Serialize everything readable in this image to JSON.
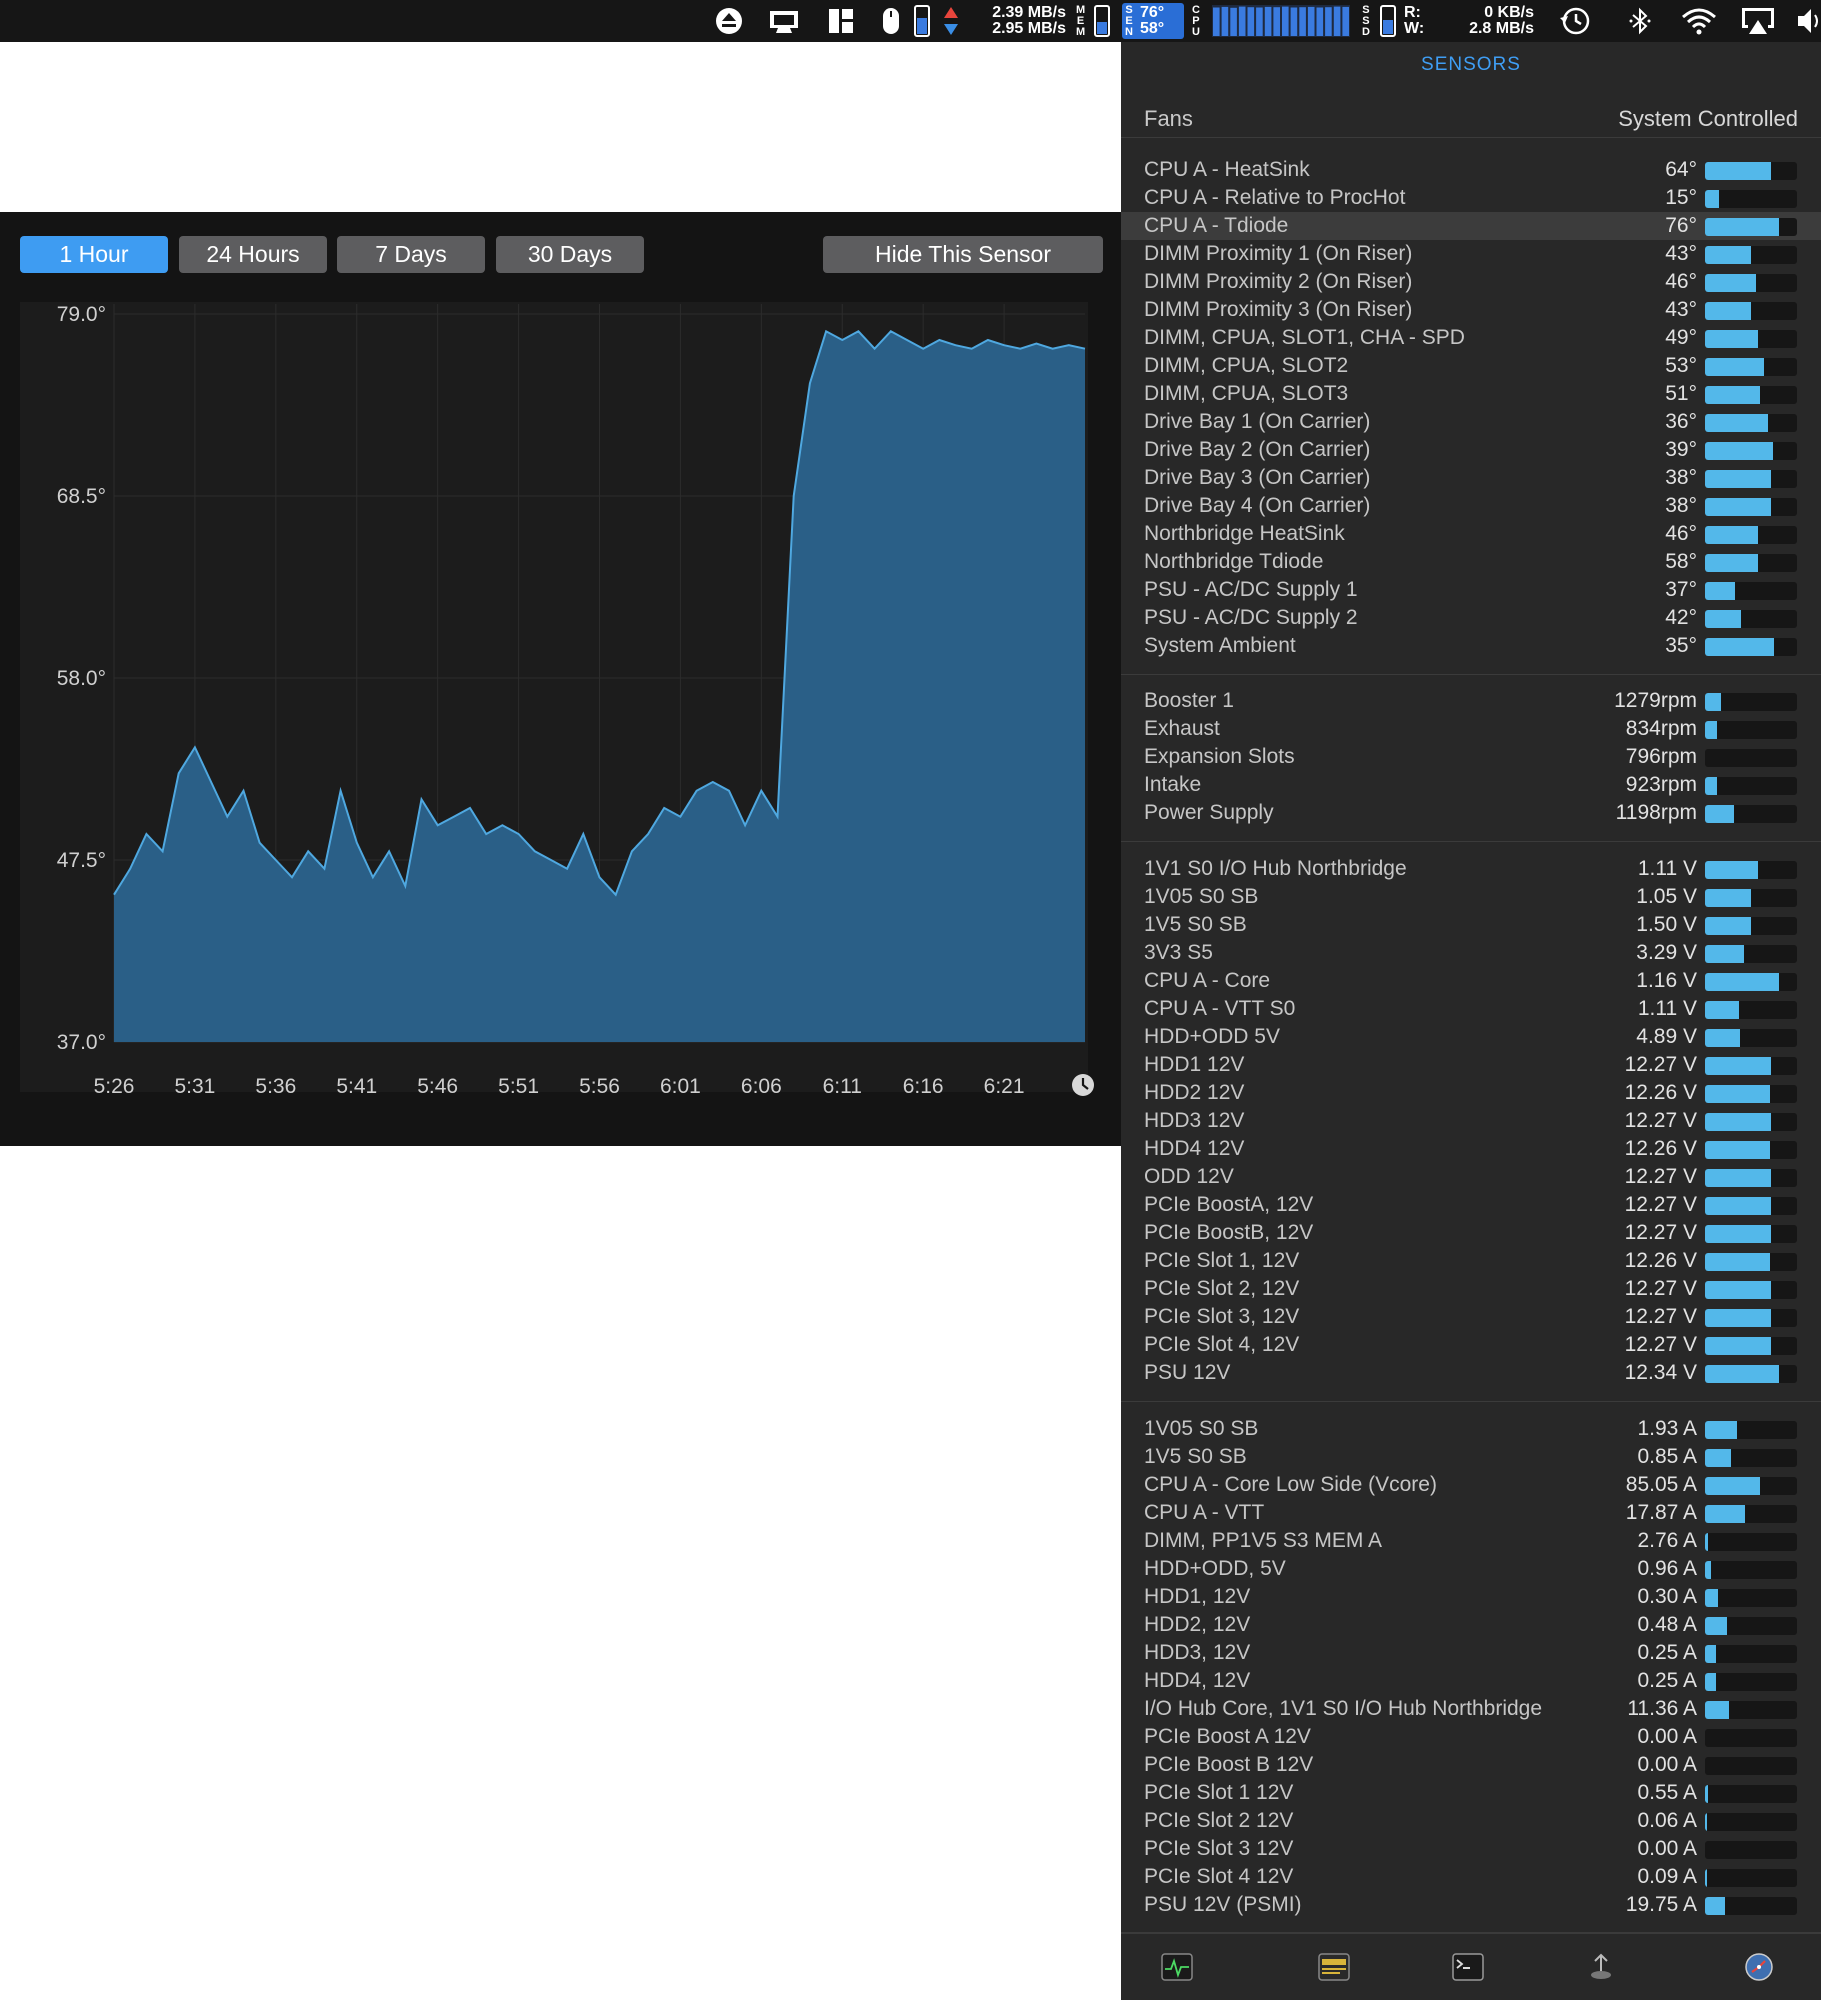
{
  "menubar": {
    "net_up": "2.39 MB/s",
    "net_down": "2.95 MB/s",
    "mem_label": "MEM",
    "sensor_label": "SEN",
    "sensor_top": "76°",
    "sensor_bottom": "58°",
    "cpu_label": "CPU",
    "cpu_bars": [
      0.95,
      0.97,
      0.94,
      0.98,
      0.96,
      0.95,
      0.97,
      0.96,
      0.98,
      0.95,
      0.96,
      0.97,
      0.95,
      0.96,
      0.98,
      0.97
    ],
    "ssd_label": "SSD",
    "disk_read_label": "R:",
    "disk_write_label": "W:",
    "disk_read": "0 KB/s",
    "disk_write": "2.8 MB/s",
    "icons": [
      "eject-icon",
      "display-icon",
      "layout-icon",
      "mouse-icon",
      "battery-icon",
      "network-arrows-icon",
      "time-machine-icon",
      "bluetooth-icon",
      "wifi-icon",
      "airplay-icon",
      "volume-icon"
    ],
    "colors": {
      "up_arrow": "#e8453c",
      "down_arrow": "#3a8ee6",
      "accent": "#3a7be0"
    }
  },
  "chart_panel": {
    "ranges": [
      "1 Hour",
      "24 Hours",
      "7 Days",
      "30 Days"
    ],
    "active_range": "1 Hour",
    "hide_button": "Hide This Sensor"
  },
  "chart_data": {
    "type": "area",
    "x_labels": [
      "5:26",
      "5:31",
      "5:36",
      "5:41",
      "5:46",
      "5:51",
      "5:56",
      "6:01",
      "6:06",
      "6:11",
      "6:16",
      "6:21"
    ],
    "y_labels": [
      "79.0°",
      "68.5°",
      "58.0°",
      "47.5°",
      "37.0°"
    ],
    "ylim": [
      37.0,
      79.0
    ],
    "xlim": [
      0,
      60
    ],
    "grid": true,
    "series": [
      {
        "x": [
          0,
          1,
          2,
          3,
          4,
          5,
          6,
          7,
          8,
          9,
          10,
          11,
          12,
          13,
          14,
          15,
          16,
          17,
          18,
          19,
          20,
          21,
          22,
          23,
          24,
          25,
          26,
          27,
          28,
          29,
          30,
          31,
          32,
          33,
          34,
          35,
          36,
          37,
          38,
          39,
          40,
          41,
          42,
          43,
          44,
          45,
          46,
          47,
          48,
          49,
          50,
          51,
          52,
          53,
          54,
          55,
          56,
          57,
          58,
          59,
          60
        ],
        "values": [
          45.5,
          47.0,
          49.0,
          48.0,
          52.5,
          54.0,
          52.0,
          50.0,
          51.5,
          48.5,
          47.5,
          46.5,
          48.0,
          47.0,
          51.5,
          48.5,
          46.5,
          48.0,
          46.0,
          51.0,
          49.5,
          50.0,
          50.5,
          49.0,
          49.5,
          49.0,
          48.0,
          47.5,
          47.0,
          49.0,
          46.5,
          45.5,
          48.0,
          49.0,
          50.5,
          50.0,
          51.5,
          52.0,
          51.5,
          49.5,
          51.5,
          50.0,
          68.5,
          75.0,
          78.0,
          77.5,
          78.0,
          77.0,
          78.0,
          77.5,
          77.0,
          77.5,
          77.2,
          77.0,
          77.5,
          77.2,
          77.0,
          77.3,
          77.0,
          77.2,
          77.0
        ],
        "fill": "#2a5f87",
        "stroke": "#4fa8e0"
      }
    ]
  },
  "sensors": {
    "title": "SENSORS",
    "fans_label": "Fans",
    "fans_mode": "System Controlled",
    "temperatures": [
      {
        "name": "CPU A - HeatSink",
        "value": "64°",
        "level": 0.72
      },
      {
        "name": "CPU A - Relative to ProcHot",
        "value": "15°",
        "level": 0.15
      },
      {
        "name": "CPU A - Tdiode",
        "value": "76°",
        "level": 0.8,
        "highlight": true
      },
      {
        "name": "DIMM Proximity 1 (On Riser)",
        "value": "43°",
        "level": 0.5
      },
      {
        "name": "DIMM Proximity 2 (On Riser)",
        "value": "46°",
        "level": 0.55
      },
      {
        "name": "DIMM Proximity 3 (On Riser)",
        "value": "43°",
        "level": 0.5
      },
      {
        "name": "DIMM, CPUA, SLOT1, CHA - SPD",
        "value": "49°",
        "level": 0.58
      },
      {
        "name": "DIMM, CPUA, SLOT2",
        "value": "53°",
        "level": 0.64
      },
      {
        "name": "DIMM, CPUA, SLOT3",
        "value": "51°",
        "level": 0.6
      },
      {
        "name": "Drive Bay 1 (On Carrier)",
        "value": "36°",
        "level": 0.68
      },
      {
        "name": "Drive Bay 2 (On Carrier)",
        "value": "39°",
        "level": 0.74
      },
      {
        "name": "Drive Bay 3 (On Carrier)",
        "value": "38°",
        "level": 0.72
      },
      {
        "name": "Drive Bay 4 (On Carrier)",
        "value": "38°",
        "level": 0.72
      },
      {
        "name": "Northbridge HeatSink",
        "value": "46°",
        "level": 0.58
      },
      {
        "name": "Northbridge Tdiode",
        "value": "58°",
        "level": 0.58
      },
      {
        "name": "PSU - AC/DC Supply 1",
        "value": "37°",
        "level": 0.33
      },
      {
        "name": "PSU - AC/DC Supply 2",
        "value": "42°",
        "level": 0.39
      },
      {
        "name": "System Ambient",
        "value": "35°",
        "level": 0.75
      }
    ],
    "fans": [
      {
        "name": "Booster 1",
        "value": "1279rpm",
        "level": 0.17
      },
      {
        "name": "Exhaust",
        "value": "834rpm",
        "level": 0.13
      },
      {
        "name": "Expansion Slots",
        "value": "796rpm",
        "level": 0
      },
      {
        "name": "Intake",
        "value": "923rpm",
        "level": 0.13
      },
      {
        "name": "Power Supply",
        "value": "1198rpm",
        "level": 0.32
      }
    ],
    "voltages": [
      {
        "name": "1V1 S0 I/O Hub Northbridge",
        "value": "1.11 V",
        "level": 0.58
      },
      {
        "name": "1V05 S0 SB",
        "value": "1.05 V",
        "level": 0.5
      },
      {
        "name": "1V5 S0 SB",
        "value": "1.50 V",
        "level": 0.5
      },
      {
        "name": "3V3 S5",
        "value": "3.29 V",
        "level": 0.42
      },
      {
        "name": "CPU A - Core",
        "value": "1.16 V",
        "level": 0.8
      },
      {
        "name": "CPU A - VTT S0",
        "value": "1.11 V",
        "level": 0.37
      },
      {
        "name": "HDD+ODD 5V",
        "value": "4.89 V",
        "level": 0.38
      },
      {
        "name": "HDD1 12V",
        "value": "12.27 V",
        "level": 0.72
      },
      {
        "name": "HDD2 12V",
        "value": "12.26 V",
        "level": 0.71
      },
      {
        "name": "HDD3 12V",
        "value": "12.27 V",
        "level": 0.72
      },
      {
        "name": "HDD4 12V",
        "value": "12.26 V",
        "level": 0.71
      },
      {
        "name": "ODD 12V",
        "value": "12.27 V",
        "level": 0.72
      },
      {
        "name": "PCIe BoostA, 12V",
        "value": "12.27 V",
        "level": 0.72
      },
      {
        "name": "PCIe BoostB, 12V",
        "value": "12.27 V",
        "level": 0.72
      },
      {
        "name": "PCIe Slot 1, 12V",
        "value": "12.26 V",
        "level": 0.71
      },
      {
        "name": "PCIe Slot 2, 12V",
        "value": "12.27 V",
        "level": 0.72
      },
      {
        "name": "PCIe Slot 3, 12V",
        "value": "12.27 V",
        "level": 0.72
      },
      {
        "name": "PCIe Slot 4, 12V",
        "value": "12.27 V",
        "level": 0.72
      },
      {
        "name": "PSU 12V",
        "value": "12.34 V",
        "level": 0.8
      }
    ],
    "currents": [
      {
        "name": "1V05 S0 SB",
        "value": "1.93 A",
        "level": 0.35
      },
      {
        "name": "1V5 S0 SB",
        "value": "0.85 A",
        "level": 0.28
      },
      {
        "name": "CPU A - Core Low Side (Vcore)",
        "value": "85.05 A",
        "level": 0.6
      },
      {
        "name": "CPU A - VTT",
        "value": "17.87 A",
        "level": 0.44
      },
      {
        "name": "DIMM, PP1V5 S3 MEM A",
        "value": "2.76 A",
        "level": 0.03
      },
      {
        "name": "HDD+ODD, 5V",
        "value": "0.96 A",
        "level": 0.07
      },
      {
        "name": "HDD1, 12V",
        "value": "0.30 A",
        "level": 0.14
      },
      {
        "name": "HDD2, 12V",
        "value": "0.48 A",
        "level": 0.24
      },
      {
        "name": "HDD3, 12V",
        "value": "0.25 A",
        "level": 0.12
      },
      {
        "name": "HDD4, 12V",
        "value": "0.25 A",
        "level": 0.12
      },
      {
        "name": "I/O Hub Core, 1V1 S0 I/O Hub Northbridge",
        "value": "11.36 A",
        "level": 0.26
      },
      {
        "name": "PCIe Boost A 12V",
        "value": "0.00 A",
        "level": 0
      },
      {
        "name": "PCIe Boost B 12V",
        "value": "0.00 A",
        "level": 0
      },
      {
        "name": "PCIe Slot 1 12V",
        "value": "0.55 A",
        "level": 0.03
      },
      {
        "name": "PCIe Slot 2 12V",
        "value": "0.06 A",
        "level": 0.02
      },
      {
        "name": "PCIe Slot 3 12V",
        "value": "0.00 A",
        "level": 0
      },
      {
        "name": "PCIe Slot 4 12V",
        "value": "0.09 A",
        "level": 0.02
      },
      {
        "name": "PSU 12V (PSMI)",
        "value": "19.75 A",
        "level": 0.22
      }
    ],
    "bottom_icons": [
      "activity-monitor-icon",
      "console-icon",
      "terminal-icon",
      "disk-utility-icon",
      "system-info-icon"
    ],
    "colors": {
      "bar_fill": "#53b8ea",
      "bar_track": "#161616",
      "title": "#3f9ef4"
    }
  }
}
